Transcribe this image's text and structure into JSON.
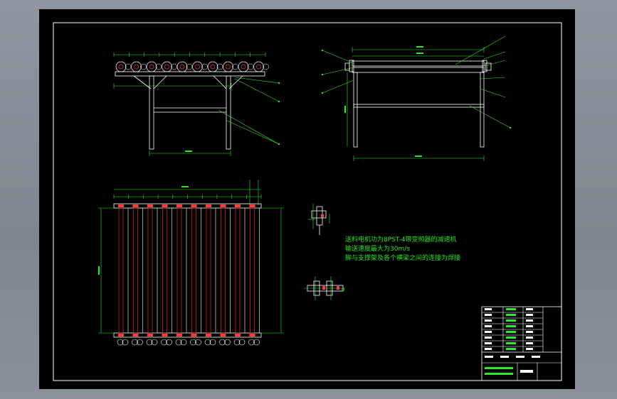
{
  "drawing": {
    "notes": [
      "送料电机功为8PST-4带变频器的减速机",
      "输送速度最大为30m/s",
      "脚与支撑架及各个横梁之间的连接为焊接"
    ]
  },
  "colors": {
    "background": "#000000",
    "frame_line": "#ffffff",
    "dimension": "#2ee82e",
    "highlight": "#ff3a3a"
  }
}
